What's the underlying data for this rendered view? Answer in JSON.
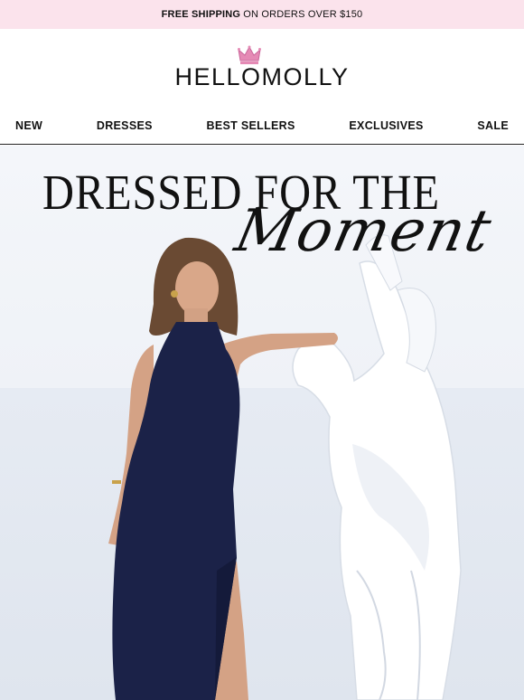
{
  "promo": {
    "bold": "FREE SHIPPING",
    "rest": "ON ORDERS OVER $150"
  },
  "brand": {
    "logo": "HELLOMOLLY",
    "crown_icon": "crown-icon",
    "crown_color": "#e58ab5"
  },
  "nav": {
    "items": [
      "NEW",
      "DRESSES",
      "BEST SELLERS",
      "EXCLUSIVES",
      "SALE"
    ]
  },
  "hero": {
    "title_line1": "DRESSED FOR THE",
    "title_line2": "Moment",
    "dress_color": "#1b2248"
  }
}
